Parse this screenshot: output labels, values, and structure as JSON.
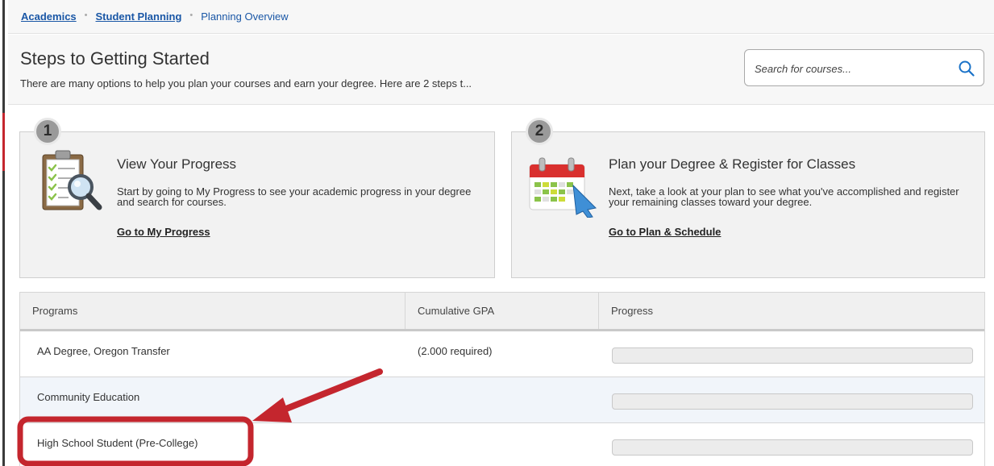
{
  "breadcrumb": {
    "items": [
      "Academics",
      "Student Planning",
      "Planning Overview"
    ]
  },
  "header": {
    "title": "Steps to Getting Started",
    "subtitle": "There are many options to help you plan your courses and earn your degree. Here are 2 steps t..."
  },
  "search": {
    "placeholder": "Search for courses..."
  },
  "steps": [
    {
      "number": "1",
      "title": "View Your Progress",
      "description": "Start by going to My Progress to see your academic progress in your degree and search for courses.",
      "link": "Go to My Progress",
      "icon": "progress-clipboard-icon"
    },
    {
      "number": "2",
      "title": "Plan your Degree & Register for Classes",
      "description": "Next, take a look at your plan to see what you've accomplished and register your remaining classes toward your degree.",
      "link": "Go to Plan & Schedule",
      "icon": "calendar-icon"
    }
  ],
  "programs_table": {
    "headers": [
      "Programs",
      "Cumulative GPA",
      "Progress"
    ],
    "rows": [
      {
        "program": "AA Degree, Oregon Transfer",
        "gpa": "(2.000 required)"
      },
      {
        "program": "Community Education",
        "gpa": ""
      },
      {
        "program": "High School Student (Pre-College)",
        "gpa": ""
      }
    ]
  },
  "colors": {
    "link": "#1a57a6",
    "annotation": "#c4262e"
  }
}
